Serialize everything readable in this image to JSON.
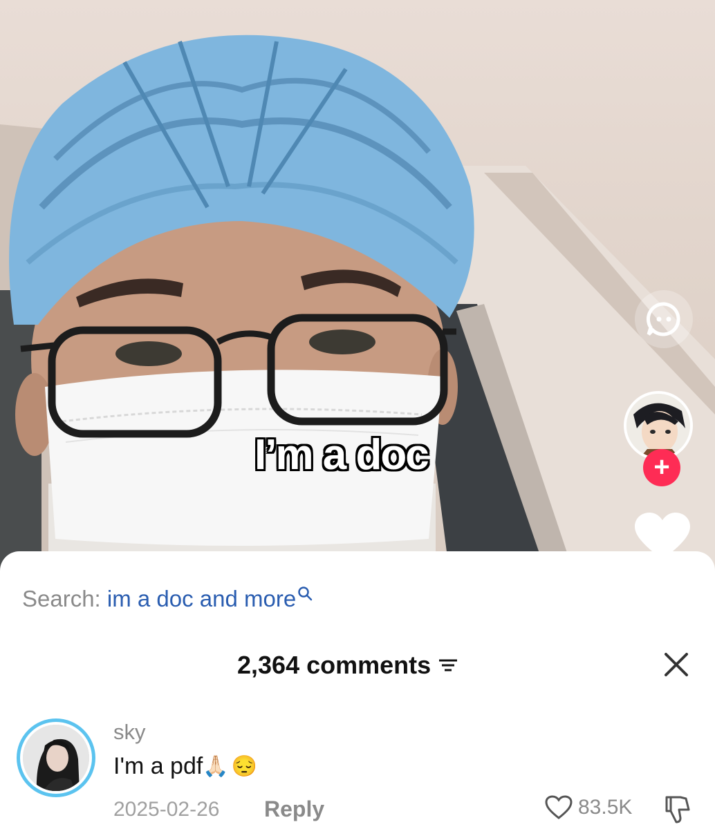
{
  "video": {
    "caption": "I’m a doc"
  },
  "side_actions": {
    "follow_plus": "+"
  },
  "search": {
    "prefix": "Search:",
    "query": "im a doc and more"
  },
  "comments": {
    "count_label": "2,364 comments",
    "items": [
      {
        "username": "sky",
        "text": "I'm a pdf",
        "emojis": [
          "🙏🏻",
          "😔"
        ],
        "date": "2025-02-26",
        "reply_label": "Reply",
        "likes": "83.5K"
      }
    ]
  },
  "colors": {
    "search_query": "#2a5db0",
    "follow_button": "#fe2c55",
    "avatar_ring": "#5bc3ef"
  }
}
